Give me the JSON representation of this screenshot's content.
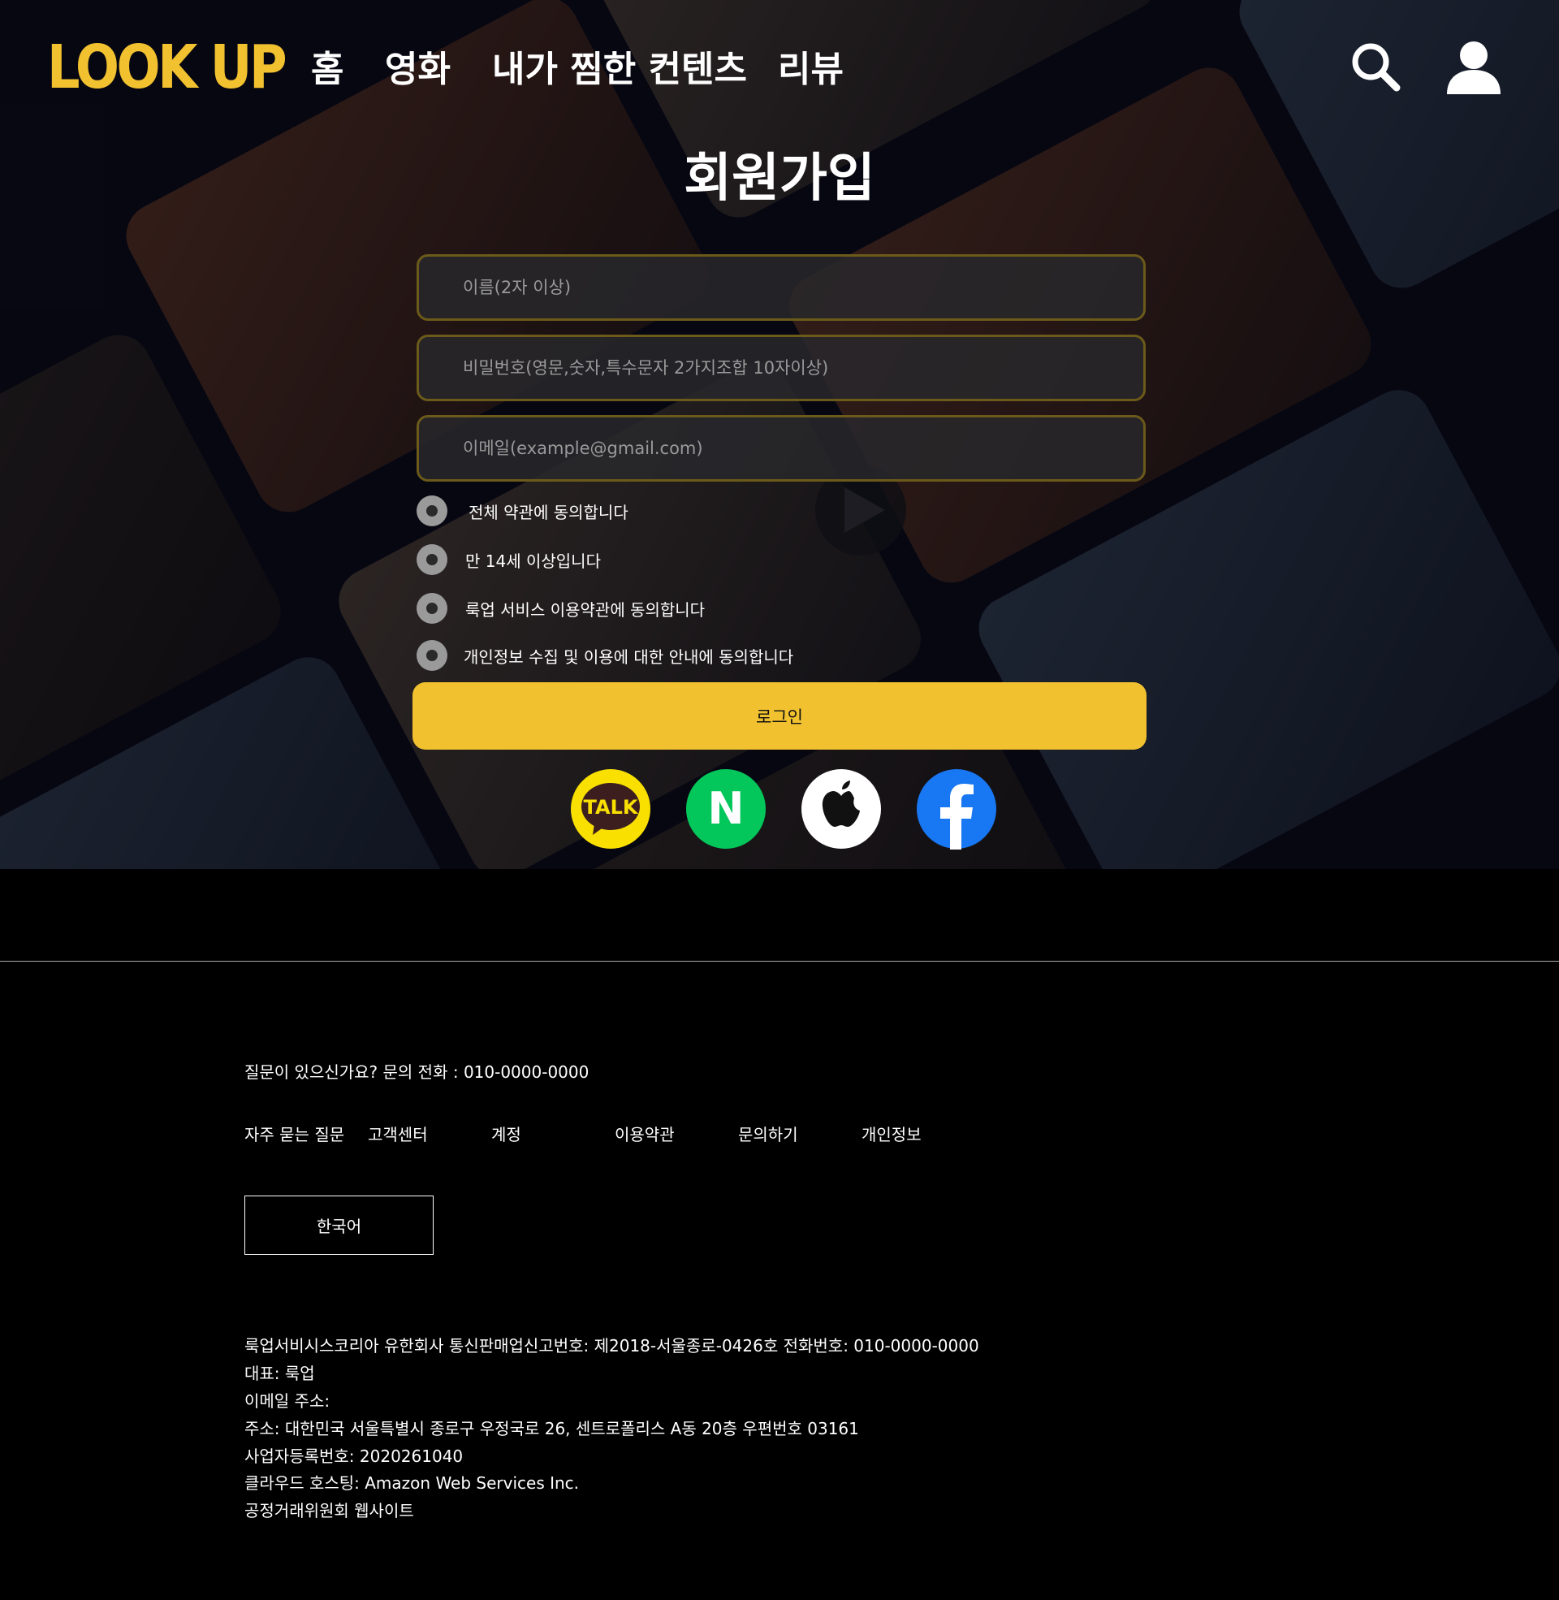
{
  "brand": {
    "logo": "LOOK UP",
    "accent": "#f1c12f"
  },
  "nav": {
    "items": [
      {
        "label": "홈"
      },
      {
        "label": "영화"
      },
      {
        "label": "내가 찜한 컨텐츠"
      },
      {
        "label": "리뷰"
      }
    ],
    "icons": [
      "search-icon",
      "user-icon"
    ]
  },
  "signup": {
    "title": "회원가입",
    "fields": [
      {
        "placeholder": "이름(2자 이상)",
        "value": ""
      },
      {
        "placeholder": "비밀번호(영문,숫자,특수문자 2가지조합 10자이상)",
        "value": ""
      },
      {
        "placeholder": "이메일(example@gmail.com)",
        "value": ""
      }
    ],
    "agreements": [
      {
        "label": "전체 약관에 동의합니다"
      },
      {
        "label": "만 14세 이상입니다"
      },
      {
        "label": "룩업 서비스 이용약관에 동의합니다"
      },
      {
        "label": "개인정보 수집 및 이용에 대한 안내에 동의합니다"
      }
    ],
    "submit_label": "로그인",
    "social": [
      {
        "name": "kakao",
        "label": "TALK",
        "color": "#f9e000"
      },
      {
        "name": "naver",
        "label": "N",
        "color": "#03c75a"
      },
      {
        "name": "apple",
        "color": "#ffffff"
      },
      {
        "name": "facebook",
        "color": "#1877f2"
      }
    ]
  },
  "footer": {
    "question": "질문이 있으신가요? 문의 전화 : 010-0000-0000",
    "links": [
      {
        "label": "자주 묻는 질문"
      },
      {
        "label": "고객센터"
      },
      {
        "label": "계정"
      },
      {
        "label": "이용약관"
      },
      {
        "label": "문의하기"
      },
      {
        "label": "개인정보"
      }
    ],
    "language": "한국어",
    "company_info": [
      "룩업서비시스코리아 유한회사 통신판매업신고번호: 제2018-서울종로-0426호 전화번호: 010-0000-0000",
      "대표: 룩업",
      "이메일 주소:",
      "주소: 대한민국 서울특별시 종로구 우정국로 26, 센트로폴리스 A동 20층 우편번호 03161",
      "사업자등록번호: 2020261040",
      "클라우드 호스팅: Amazon Web Services Inc.",
      "공정거래위원회 웹사이트"
    ]
  }
}
